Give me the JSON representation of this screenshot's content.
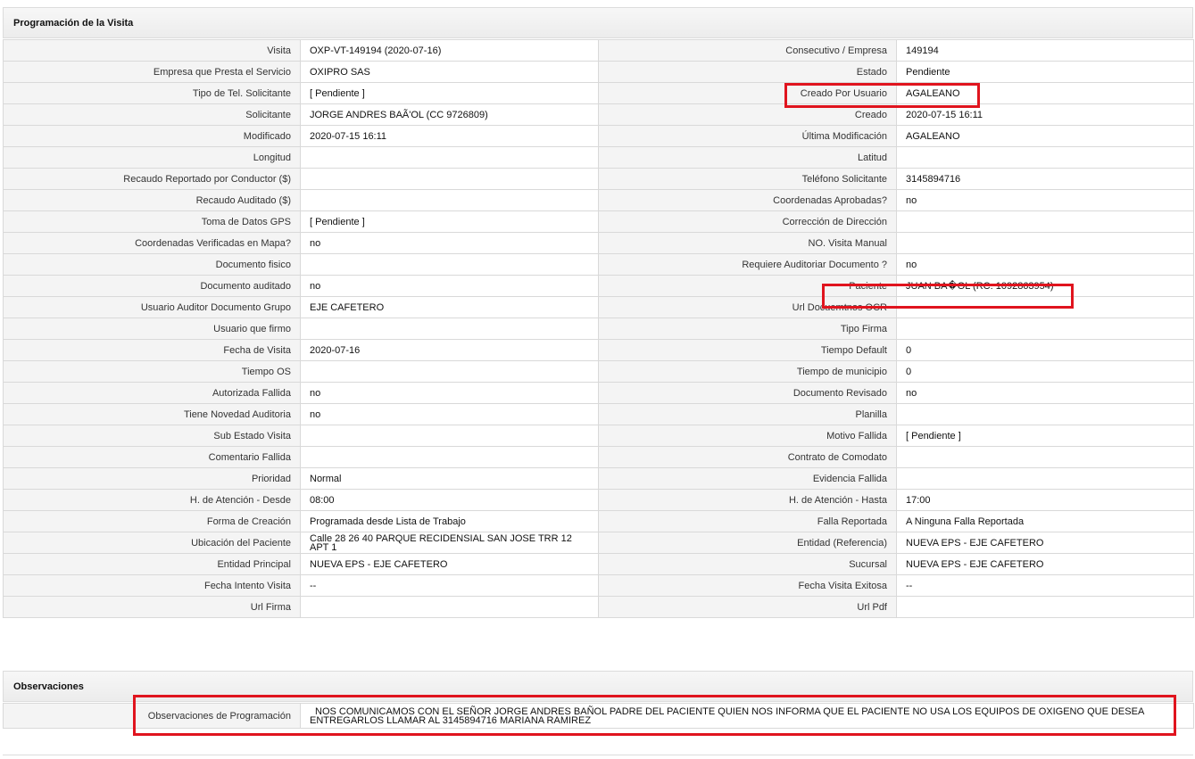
{
  "visit_panel": {
    "title": "Programación de la Visita",
    "rows": [
      [
        "Visita",
        "OXP-VT-149194 (2020-07-16)",
        "Consecutivo / Empresa",
        "149194"
      ],
      [
        "Empresa que Presta el Servicio",
        "OXIPRO SAS",
        "Estado",
        "Pendiente"
      ],
      [
        "Tipo de Tel. Solicitante",
        "[ Pendiente ]",
        "Creado Por Usuario",
        "AGALEANO"
      ],
      [
        "Solicitante",
        "JORGE ANDRES BAÃ'OL (CC 9726809)",
        "Creado",
        "2020-07-15 16:11"
      ],
      [
        "Modificado",
        "2020-07-15 16:11",
        "Última Modificación",
        " AGALEANO"
      ],
      [
        "Longitud",
        "",
        "Latitud",
        ""
      ],
      [
        "Recaudo Reportado por Conductor ($)",
        "",
        "Teléfono Solicitante",
        "3145894716"
      ],
      [
        "Recaudo Auditado ($)",
        "",
        "Coordenadas Aprobadas?",
        " no"
      ],
      [
        "Toma de Datos GPS",
        "[ Pendiente ]",
        "Corrección de Dirección",
        ""
      ],
      [
        "Coordenadas Verificadas en Mapa?",
        " no",
        "NO. Visita Manual",
        ""
      ],
      [
        "Documento fisico",
        "",
        "Requiere Auditoriar Documento ?",
        " no"
      ],
      [
        "Documento auditado",
        " no",
        "Paciente",
        "JUAN BA�OL (RC: 1092863954)"
      ],
      [
        "Usuario Auditor Documento Grupo",
        "EJE CAFETERO",
        "Url Docuemtnos OCR",
        ""
      ],
      [
        "Usuario que firmo",
        "",
        "Tipo Firma",
        ""
      ],
      [
        "Fecha de Visita",
        " 2020-07-16",
        "Tiempo Default",
        "0"
      ],
      [
        "Tiempo OS",
        "",
        "Tiempo de municipio",
        "0"
      ],
      [
        "Autorizada Fallida",
        " no",
        "Documento Revisado",
        " no"
      ],
      [
        "Tiene Novedad Auditoria",
        " no",
        "Planilla",
        ""
      ],
      [
        "Sub Estado Visita",
        "",
        "Motivo Fallida",
        "[ Pendiente ]"
      ],
      [
        "Comentario Fallida",
        "",
        "Contrato de Comodato",
        ""
      ],
      [
        "Prioridad",
        "Normal",
        "Evidencia Fallida",
        ""
      ],
      [
        "H. de Atención - Desde",
        "08:00",
        "H. de Atención - Hasta",
        "17:00"
      ],
      [
        "Forma de Creación",
        "Programada desde Lista de Trabajo",
        "Falla Reportada",
        "A Ninguna Falla Reportada"
      ],
      [
        "Ubicación del Paciente",
        "Calle 28 26 40 PARQUE RECIDENSIAL SAN JOSE TRR 12 APT 1",
        "Entidad (Referencia)",
        "NUEVA EPS - EJE CAFETERO"
      ],
      [
        "Entidad Principal",
        "NUEVA EPS - EJE CAFETERO",
        "Sucursal",
        "NUEVA EPS - EJE CAFETERO"
      ],
      [
        "Fecha Intento Visita",
        " --",
        "Fecha Visita Exitosa",
        " --"
      ],
      [
        "Url Firma",
        "",
        "Url Pdf",
        ""
      ]
    ]
  },
  "observations_panel": {
    "title": "Observaciones",
    "label": "Observaciones de Programación",
    "value": "NOS COMUNICAMOS CON EL SEÑOR JORGE ANDRES BAÑOL PADRE DEL PACIENTE QUIEN NOS INFORMA QUE EL PACIENTE NO USA LOS EQUIPOS DE OXIGENO QUE DESEA ENTREGARLOS LLAMAR AL 3145894716 MARIANA RAMIREZ"
  },
  "highlight_color": "#e0141e"
}
